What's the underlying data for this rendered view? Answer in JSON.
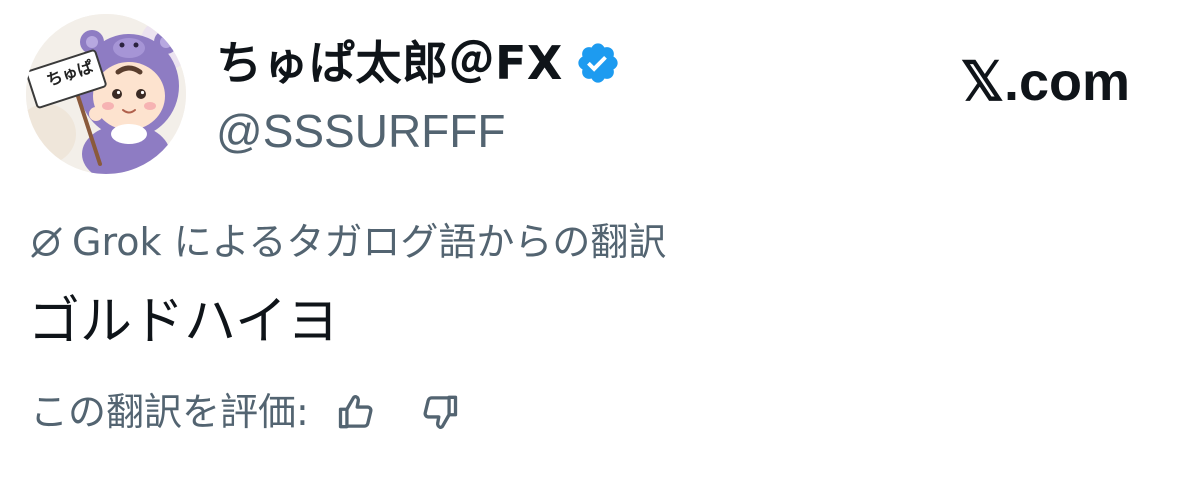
{
  "author": {
    "display_name": "ちゅぱ太郎＠FX",
    "handle": "@SSSURFFF",
    "verified": true,
    "avatar_sign_text": "ちゅぱ"
  },
  "brand": {
    "logo_text": "𝕏.com"
  },
  "translation": {
    "label": "Grok によるタガログ語からの翻訳",
    "text": "ゴルドハイヨ",
    "rate_label": "この翻訳を評価:"
  },
  "icons": {
    "verified": "verified-badge-icon",
    "grok": "grok-icon",
    "thumb_up": "thumbs-up-icon",
    "thumb_down": "thumbs-down-icon"
  },
  "colors": {
    "text_primary": "#0f1419",
    "text_secondary": "#536471",
    "verified_blue": "#1d9bf0",
    "avatar_purple": "#8e7cc3"
  }
}
